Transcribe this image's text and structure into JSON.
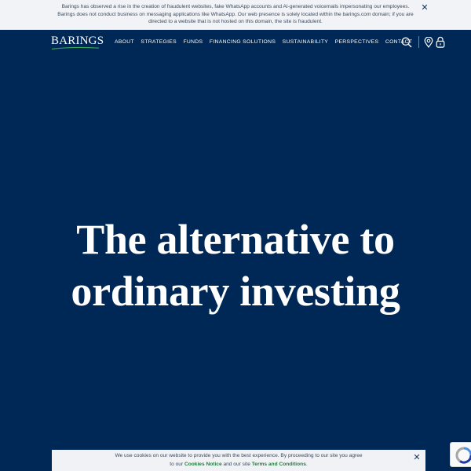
{
  "alert": {
    "message": "Barings has observed a rise in the creation of fraudulent websites, fake WhatsApp accounts and AI-generated voicemails impersonating our employees. Barings does not conduct business on messaging applications like WhatsApp. Our web presence is solely located within the barings.com domain; if you are directed to a website that is not hosted on this domain, the site is fraudulent.",
    "close_label": "✕"
  },
  "header": {
    "logo_text": "BARINGS",
    "nav": [
      "ABOUT",
      "STRATEGIES",
      "FUNDS",
      "FINANCING SOLUTIONS",
      "SUSTAINABILITY",
      "PERSPECTIVES",
      "CONTACT"
    ],
    "icons": [
      "search-icon",
      "location-pin-icon",
      "lock-icon"
    ]
  },
  "hero": {
    "title_line1": "The alternative to",
    "title_line2": "ordinary investing"
  },
  "cookie": {
    "text_before": "We use cookies on our website to provide you with the best experience. By proceeding to our site you agree to our ",
    "cookies_notice_link": "Cookies Notice",
    "text_middle": " and our site ",
    "terms_link": "Terms and Conditions",
    "text_after": ".",
    "close_label": "✕"
  },
  "colors": {
    "navy": "#002856",
    "banner_bg": "#f2f3f6",
    "link_green": "#2a7a43",
    "logo_green": "#3aa655"
  }
}
